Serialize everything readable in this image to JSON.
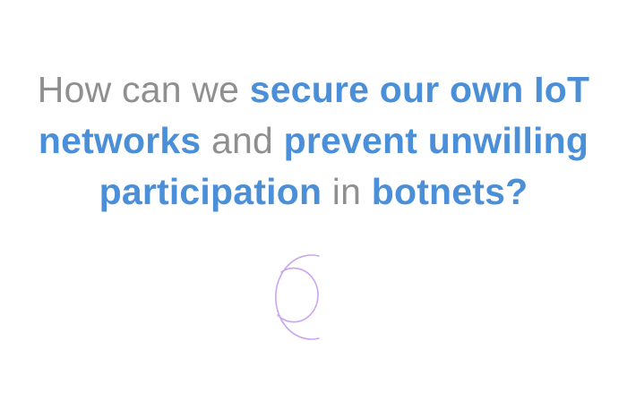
{
  "headline": {
    "line1_plain": "How can we",
    "line1_highlight": "secure our own IoT",
    "line2_highlight_a": "networks",
    "line2_plain": "and",
    "line2_highlight_b": "prevent unwilling",
    "line3_highlight_a": "participation",
    "line3_plain": "in",
    "line3_highlight_b": "botnets?"
  },
  "colors": {
    "highlight_text": "#4a8fd8",
    "plain_text": "#8f8f8f",
    "spinner": "#c9a6f0"
  },
  "icons": {
    "loading": "loading-spinner-icon"
  }
}
